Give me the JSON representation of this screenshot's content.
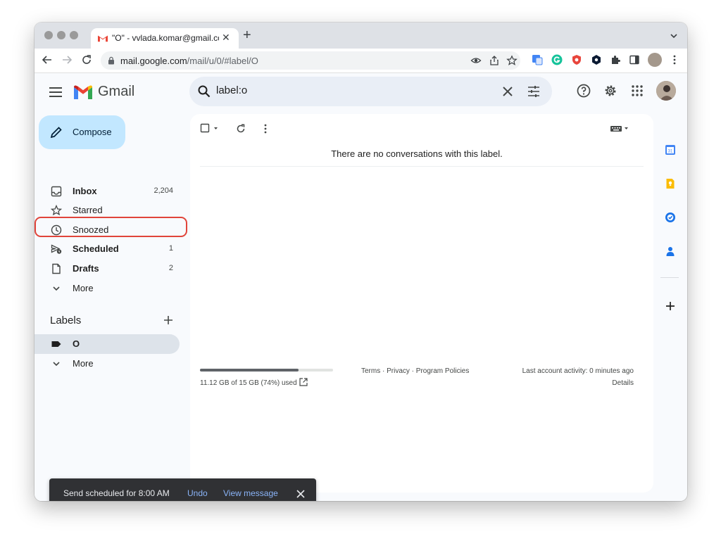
{
  "browser": {
    "tab_title": "\"O\" - vvlada.komar@gmail.com",
    "url_host": "mail.google.com",
    "url_path": "/mail/u/0/#label/O"
  },
  "gmail": {
    "logo_text": "Gmail",
    "search_value": "label:o",
    "compose_label": "Compose",
    "nav": [
      {
        "label": "Inbox",
        "count": "2,204"
      },
      {
        "label": "Starred",
        "count": ""
      },
      {
        "label": "Snoozed",
        "count": ""
      },
      {
        "label": "Scheduled",
        "count": "1"
      },
      {
        "label": "Drafts",
        "count": "2"
      },
      {
        "label": "More",
        "count": ""
      }
    ],
    "labels_heading": "Labels",
    "labels": [
      {
        "label": "O"
      }
    ],
    "labels_more": "More",
    "empty_message": "There are no conversations with this label.",
    "storage": {
      "text": "11.12 GB of 15 GB (74%) used",
      "fraction": 0.74
    },
    "footer_links": "Terms · Privacy · Program Policies",
    "last_activity": "Last account activity: 0 minutes ago",
    "details": "Details"
  },
  "snackbar": {
    "text": "Send scheduled for 8:00 AM",
    "undo": "Undo",
    "view": "View message"
  },
  "colors": {
    "accent": "#0b57d0",
    "compose_bg": "#c2e7ff",
    "highlight_border": "#e0443a"
  }
}
